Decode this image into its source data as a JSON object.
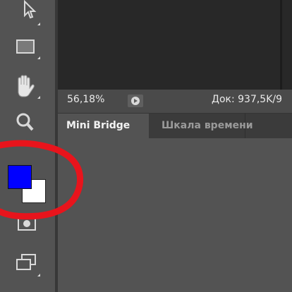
{
  "status_bar": {
    "zoom": "56,18%",
    "doc_info": "Док: 937,5K/9"
  },
  "tabs": [
    {
      "label": "Mini Bridge",
      "active": true
    },
    {
      "label": "Шкала времени",
      "active": false
    }
  ],
  "tools": [
    {
      "icon": "move-arrow-icon"
    },
    {
      "icon": "rectangle-icon"
    },
    {
      "icon": "hand-icon"
    },
    {
      "icon": "zoom-magnifier-icon"
    },
    {
      "icon": "foreground-background-color-icon"
    },
    {
      "icon": "quick-mask-icon"
    },
    {
      "icon": "screen-mode-icon"
    }
  ],
  "colors": {
    "foreground": "#0000ff",
    "background": "#ffffff",
    "annotation": "#e8141c"
  }
}
